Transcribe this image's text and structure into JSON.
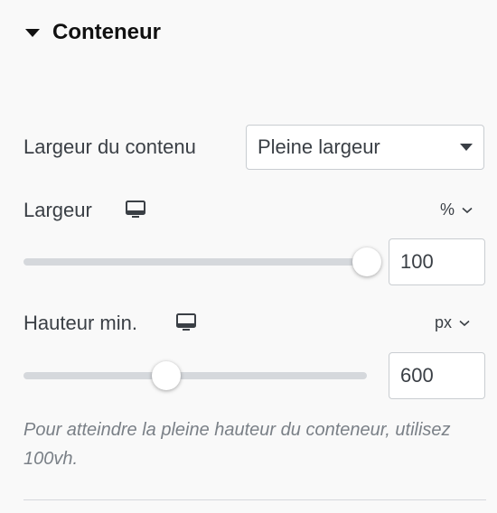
{
  "section": {
    "title": "Conteneur",
    "expanded": true
  },
  "content_width": {
    "label": "Largeur du contenu",
    "selected": "Pleine largeur"
  },
  "width": {
    "label": "Largeur",
    "responsive_icon": "desktop-icon",
    "unit": "%",
    "value": "100",
    "slider_fraction": 1.0
  },
  "min_height": {
    "label": "Hauteur min.",
    "responsive_icon": "desktop-icon",
    "unit": "px",
    "value": "600",
    "slider_fraction": 0.415
  },
  "help_text": "Pour atteindre la pleine hauteur du conteneur, utilisez 100vh."
}
